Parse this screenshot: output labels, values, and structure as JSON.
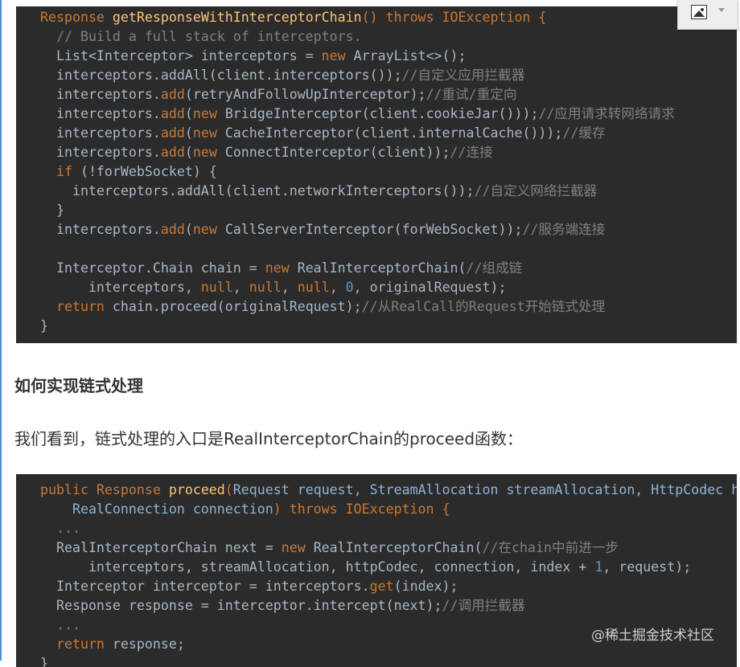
{
  "code_block_1": [
    [
      [
        "k",
        "Response "
      ],
      [
        "f",
        "getResponseWithInterceptorChain"
      ],
      [
        "k",
        "() throws IOException {"
      ]
    ],
    [
      [
        "c",
        "  // Build a full stack of interceptors."
      ]
    ],
    [
      [
        "t",
        "  List<Interceptor> interceptors = "
      ],
      [
        "k",
        "new "
      ],
      [
        "t",
        "ArrayList<>();"
      ]
    ],
    [
      [
        "t",
        "  interceptors.addAll(client.interceptors());"
      ],
      [
        "c",
        "//自定义应用拦截器"
      ]
    ],
    [
      [
        "t",
        "  interceptors."
      ],
      [
        "k",
        "add"
      ],
      [
        "t",
        "(retryAndFollowUpInterceptor);"
      ],
      [
        "c",
        "//重试/重定向"
      ]
    ],
    [
      [
        "t",
        "  interceptors."
      ],
      [
        "k",
        "add"
      ],
      [
        "t",
        "("
      ],
      [
        "k",
        "new "
      ],
      [
        "t",
        "BridgeInterceptor(client.cookieJar()));"
      ],
      [
        "c",
        "//应用请求转网络请求"
      ]
    ],
    [
      [
        "t",
        "  interceptors."
      ],
      [
        "k",
        "add"
      ],
      [
        "t",
        "("
      ],
      [
        "k",
        "new "
      ],
      [
        "t",
        "CacheInterceptor(client.internalCache()));"
      ],
      [
        "c",
        "//缓存"
      ]
    ],
    [
      [
        "t",
        "  interceptors."
      ],
      [
        "k",
        "add"
      ],
      [
        "t",
        "("
      ],
      [
        "k",
        "new "
      ],
      [
        "t",
        "ConnectInterceptor(client));"
      ],
      [
        "c",
        "//连接"
      ]
    ],
    [
      [
        "k",
        "  if "
      ],
      [
        "t",
        "(!forWebSocket) {"
      ]
    ],
    [
      [
        "t",
        "    interceptors.addAll(client.networkInterceptors());"
      ],
      [
        "c",
        "//自定义网络拦截器"
      ]
    ],
    [
      [
        "t",
        "  }"
      ]
    ],
    [
      [
        "t",
        "  interceptors."
      ],
      [
        "k",
        "add"
      ],
      [
        "t",
        "("
      ],
      [
        "k",
        "new "
      ],
      [
        "t",
        "CallServerInterceptor(forWebSocket));"
      ],
      [
        "c",
        "//服务端连接"
      ]
    ],
    [
      [
        "t",
        " "
      ]
    ],
    [
      [
        "t",
        "  Interceptor.Chain chain = "
      ],
      [
        "k",
        "new "
      ],
      [
        "t",
        "RealInterceptorChain("
      ],
      [
        "c",
        "//组成链"
      ]
    ],
    [
      [
        "t",
        "      interceptors, "
      ],
      [
        "k",
        "null"
      ],
      [
        "t",
        ", "
      ],
      [
        "k",
        "null"
      ],
      [
        "t",
        ", "
      ],
      [
        "k",
        "null"
      ],
      [
        "t",
        ", "
      ],
      [
        "n",
        "0"
      ],
      [
        "t",
        ", originalRequest);"
      ]
    ],
    [
      [
        "k",
        "  return "
      ],
      [
        "t",
        "chain.proceed(originalRequest);"
      ],
      [
        "c",
        "//从RealCall的Request开始链式处理"
      ]
    ],
    [
      [
        "t",
        "}"
      ]
    ]
  ],
  "heading": "如何实现链式处理",
  "paragraph": "我们看到，链式处理的入口是RealInterceptorChain的proceed函数：",
  "code_block_2": [
    [
      [
        "k",
        "public Response "
      ],
      [
        "f",
        "proceed"
      ],
      [
        "k",
        "("
      ],
      [
        "p",
        "Request request, StreamAllocation streamAllocation, HttpCodec httpCodec,"
      ]
    ],
    [
      [
        "p",
        "    RealConnection connection"
      ],
      [
        "k",
        ") throws IOException {"
      ]
    ],
    [
      [
        "c",
        "  ..."
      ]
    ],
    [
      [
        "t",
        "  RealInterceptorChain next = "
      ],
      [
        "k",
        "new "
      ],
      [
        "t",
        "RealInterceptorChain("
      ],
      [
        "c",
        "//在chain中前进一步"
      ]
    ],
    [
      [
        "t",
        "      interceptors, streamAllocation, httpCodec, connection, index + "
      ],
      [
        "n",
        "1"
      ],
      [
        "t",
        ", request);"
      ]
    ],
    [
      [
        "t",
        "  Interceptor interceptor = interceptors."
      ],
      [
        "k",
        "get"
      ],
      [
        "t",
        "(index);"
      ]
    ],
    [
      [
        "t",
        "  Response response = interceptor.intercept(next);"
      ],
      [
        "c",
        "//调用拦截器"
      ]
    ],
    [
      [
        "c",
        "  ..."
      ]
    ],
    [
      [
        "k",
        "  return "
      ],
      [
        "t",
        "response;"
      ]
    ],
    [
      [
        "t",
        "}"
      ]
    ]
  ],
  "watermark": "@稀土掘金技术社区",
  "image_toolbar": {
    "icon": "image-icon",
    "dropdown": "caret-down-icon"
  },
  "colors": {
    "code_bg": "#2b2b2b",
    "keyword": "#cc7832",
    "function": "#ffc66d",
    "text": "#a9b7c6",
    "comment": "#808080",
    "number": "#6897bb"
  }
}
